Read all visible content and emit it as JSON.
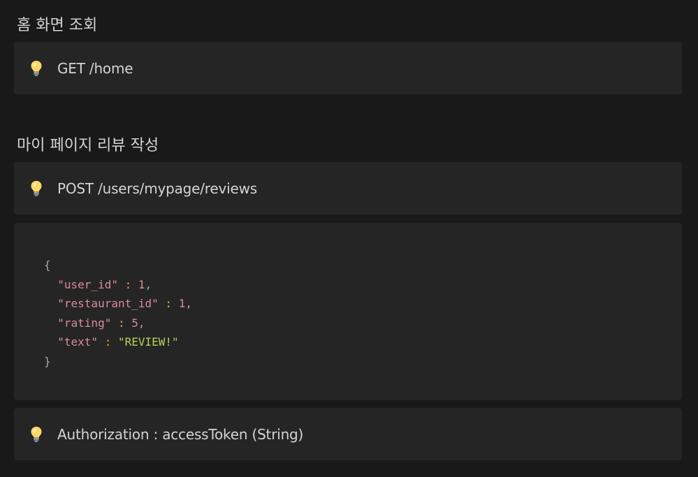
{
  "sections": {
    "home": {
      "heading": "홈 화면 조회",
      "endpoint": "GET /home"
    },
    "review": {
      "heading": "마이 페이지 리뷰 작성",
      "endpoint": "POST /users/mypage/reviews",
      "body": {
        "open_brace": "{",
        "close_brace": "}",
        "fields": [
          {
            "key": "\"user_id\"",
            "value": "1",
            "sep": ","
          },
          {
            "key": "\"restaurant_id\"",
            "value": "1",
            "sep": ","
          },
          {
            "key": "\"rating\"",
            "value": "5",
            "sep": ","
          },
          {
            "key": "\"text\"",
            "value": "\"REVIEW!\"",
            "sep": ""
          }
        ]
      },
      "auth_note": "Authorization : accessToken (String)"
    }
  },
  "icons": {
    "callout_icon": "lightbulb-icon"
  },
  "colors": {
    "background": "#191919",
    "block": "#252525",
    "key": "#d98c98",
    "colon": "#f0a44a",
    "string": "#b5d25a"
  }
}
